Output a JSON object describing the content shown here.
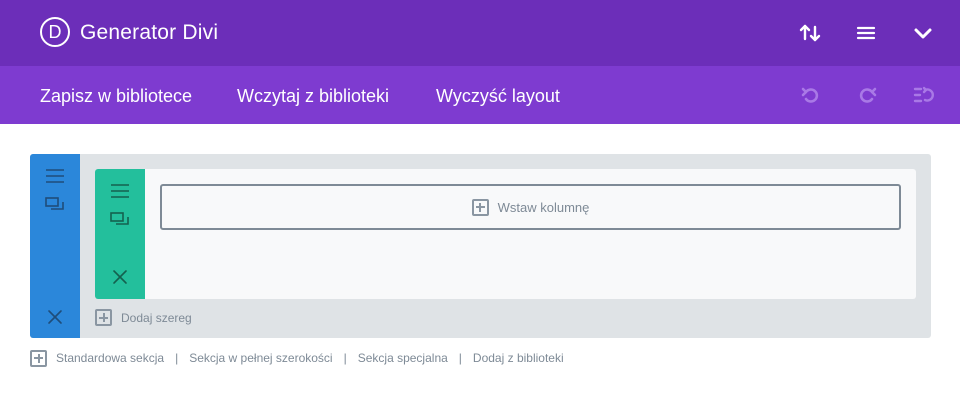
{
  "header": {
    "logo_letter": "D",
    "title": "Generator Divi",
    "icons": [
      "sort-arrows-icon",
      "hamburger-menu-icon",
      "chevron-down-icon"
    ],
    "color": "#6c2eb9"
  },
  "toolbar": {
    "save_label": "Zapisz w bibliotece",
    "load_label": "Wczytaj z biblioteki",
    "clear_label": "Wyczyść layout",
    "icons": [
      "undo-icon",
      "redo-icon",
      "history-icon"
    ],
    "color": "#7e3bd0"
  },
  "section": {
    "color": "#2b87da",
    "icons": [
      "hamburger-icon",
      "duplicate-icon",
      "close-icon"
    ],
    "row": {
      "color": "#23bf9c",
      "icons": [
        "hamburger-icon",
        "duplicate-icon",
        "close-icon"
      ],
      "insert_column_label": "Wstaw kolumnę"
    },
    "add_row_label": "Dodaj szereg"
  },
  "footer": {
    "standard_section": "Standardowa sekcja",
    "fullwidth_section": "Sekcja w pełnej szerokości",
    "special_section": "Sekcja specjalna",
    "add_from_library": "Dodaj z biblioteki",
    "separator": "|"
  }
}
